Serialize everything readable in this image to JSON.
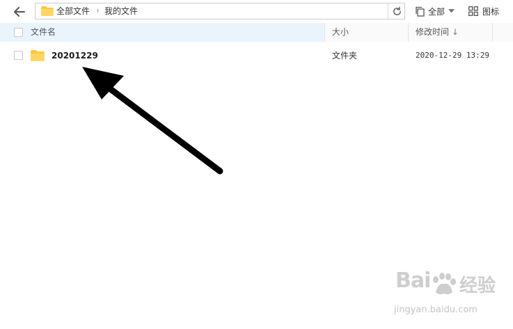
{
  "toolbar": {
    "breadcrumb": [
      "全部文件",
      "我的文件"
    ],
    "breadcrumb_separator": "›",
    "view_filter_label": "全部",
    "view_mode_label": "图标"
  },
  "columns": {
    "name": "文件名",
    "size": "大小",
    "modified": "修改时间",
    "sort_indicator": "↓"
  },
  "files": [
    {
      "name": "20201229",
      "type": "文件夹",
      "modified": "2020-12-29 13:29",
      "icon": "folder-icon"
    }
  ],
  "watermark": {
    "brand_left": "Bai",
    "brand_right": "经验",
    "url": "jingyan.baidu.com"
  },
  "colors": {
    "folder": "#ffc83d",
    "header_selected": "#eaf4fc",
    "annotation_arrow": "#000000"
  }
}
